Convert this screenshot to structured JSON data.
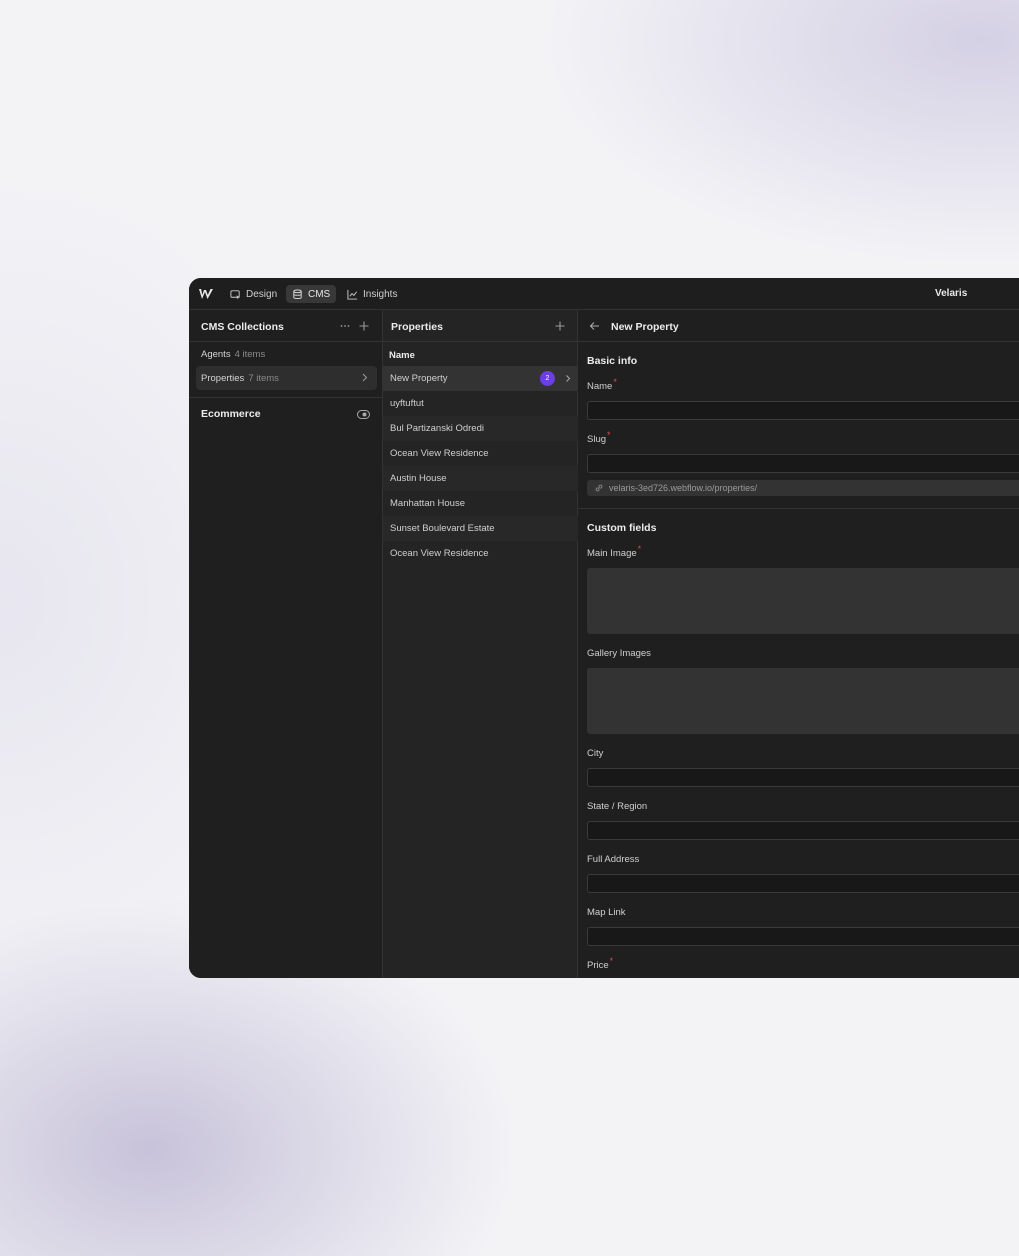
{
  "topbar": {
    "tabs": [
      {
        "label": "Design",
        "icon": "design-icon",
        "active": false
      },
      {
        "label": "CMS",
        "icon": "database-icon",
        "active": true
      },
      {
        "label": "Insights",
        "icon": "chart-line-icon",
        "active": false
      }
    ],
    "site_name": "Velaris"
  },
  "collections": {
    "title": "CMS Collections",
    "items": [
      {
        "label": "Agents",
        "count": "4 items"
      },
      {
        "label": "Properties",
        "count": "7 items"
      }
    ],
    "ecommerce_label": "Ecommerce"
  },
  "items_panel": {
    "title": "Properties",
    "column_header": "Name",
    "rows": [
      {
        "name": "New Property",
        "badge": "2"
      },
      {
        "name": "uyftuftut"
      },
      {
        "name": "Bul Partizanski Odredi"
      },
      {
        "name": "Ocean View Residence"
      },
      {
        "name": "Austin House"
      },
      {
        "name": "Manhattan House"
      },
      {
        "name": "Sunset Boulevard Estate"
      },
      {
        "name": "Ocean View Residence"
      }
    ]
  },
  "editor": {
    "title": "New Property",
    "basic_info_title": "Basic info",
    "name_label": "Name",
    "slug_label": "Slug",
    "slug_hint": "velaris-3ed726.webflow.io/properties/",
    "custom_fields_title": "Custom fields",
    "main_image_label": "Main Image",
    "gallery_images_label": "Gallery Images",
    "city_label": "City",
    "state_label": "State / Region",
    "full_address_label": "Full Address",
    "map_link_label": "Map Link",
    "price_label": "Price",
    "required_mark": "*"
  },
  "colors": {
    "accent": "#6b3fe0",
    "required": "#e5484d",
    "panel_bg": "#1f1f1f"
  }
}
